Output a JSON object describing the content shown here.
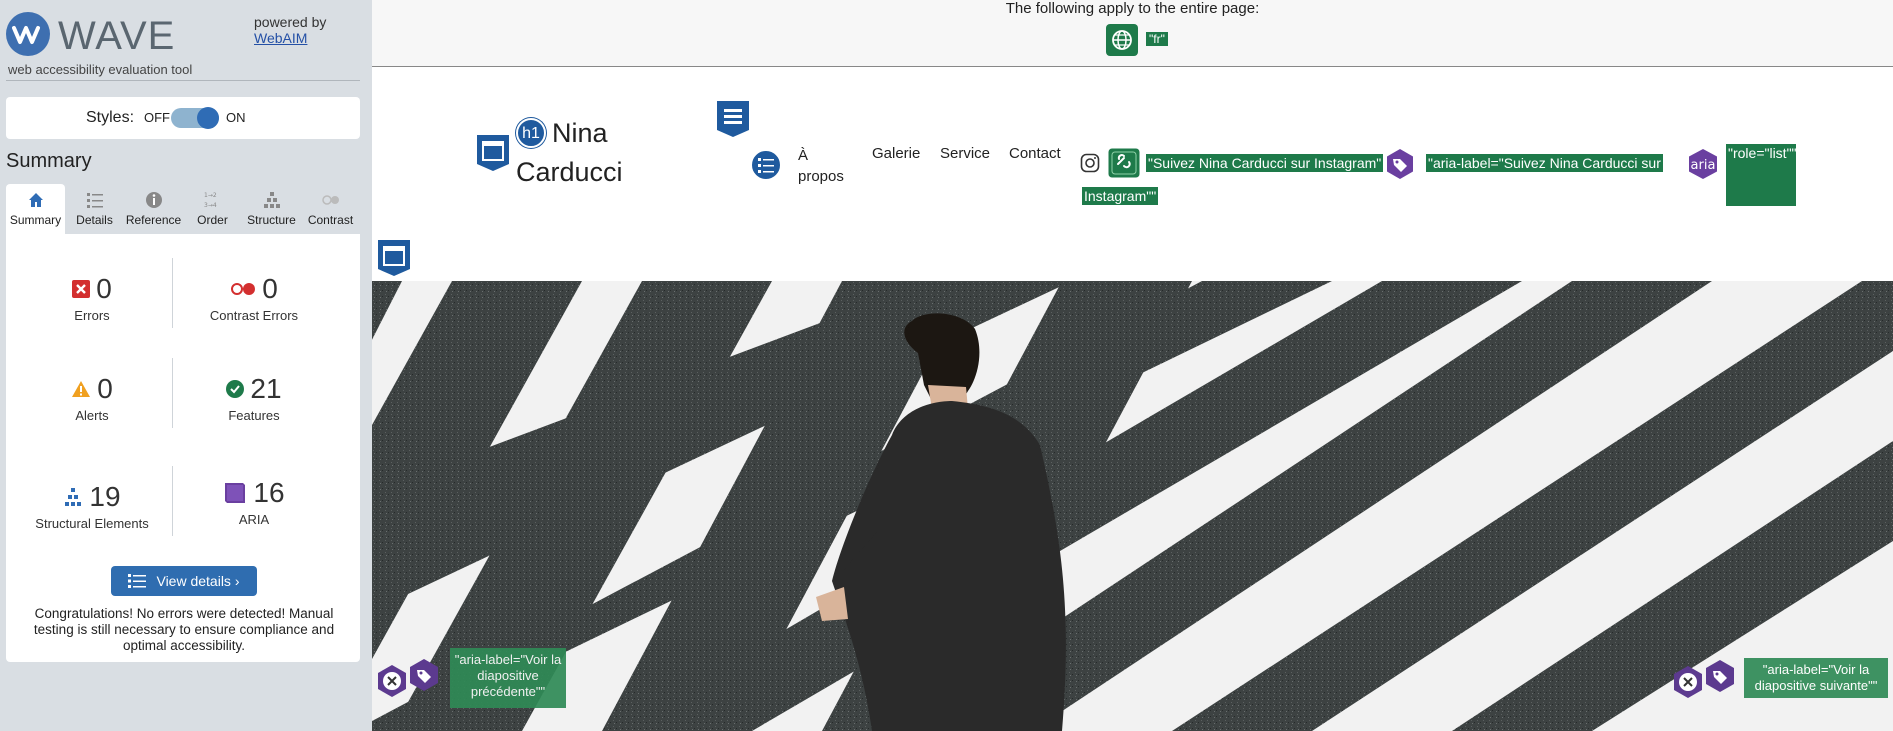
{
  "sidebar": {
    "logo_word": "WAVE",
    "logo_tagline": "web accessibility evaluation tool",
    "powered_by": "powered by",
    "powered_link": "WebAIM",
    "styles_label": "Styles:",
    "styles_off": "OFF",
    "styles_on": "ON",
    "summary_title": "Summary",
    "tabs": [
      {
        "label": "Summary"
      },
      {
        "label": "Details"
      },
      {
        "label": "Reference"
      },
      {
        "label": "Order"
      },
      {
        "label": "Structure"
      },
      {
        "label": "Contrast"
      }
    ],
    "stats": {
      "errors": {
        "value": "0",
        "label": "Errors"
      },
      "contrast_errors": {
        "value": "0",
        "label": "Contrast Errors"
      },
      "alerts": {
        "value": "0",
        "label": "Alerts"
      },
      "features": {
        "value": "21",
        "label": "Features"
      },
      "structural": {
        "value": "19",
        "label": "Structural Elements"
      },
      "aria": {
        "value": "16",
        "label": "ARIA"
      }
    },
    "view_details": "View details ›",
    "congrats": "Congratulations! No errors were detected! Manual testing is still necessary to ensure compliance and optimal accessibility."
  },
  "page": {
    "apply_text": "The following apply to the entire page:",
    "lang_tag": "\"fr\"",
    "site_title_line1": "Nina",
    "site_title_line2": "Carducci",
    "h1_badge": "h1",
    "nav": {
      "apropos_1": "À",
      "apropos_2": "propos",
      "galerie": "Galerie",
      "service": "Service",
      "contact": "Contact"
    },
    "instagram_text": "\"Suivez Nina Carducci sur Instagram\"",
    "instagram_aria_1": "\"aria-label=\"Suivez Nina Carducci sur",
    "instagram_aria_2": "Instagram\"\"",
    "aria_badge": "aria",
    "role_list": "\"role=\"list\"\"",
    "prev_label": "\"aria-label=\"Voir la diapositive précédente\"\"",
    "next_label": "\"aria-label=\"Voir la diapositive suivante\"\""
  }
}
